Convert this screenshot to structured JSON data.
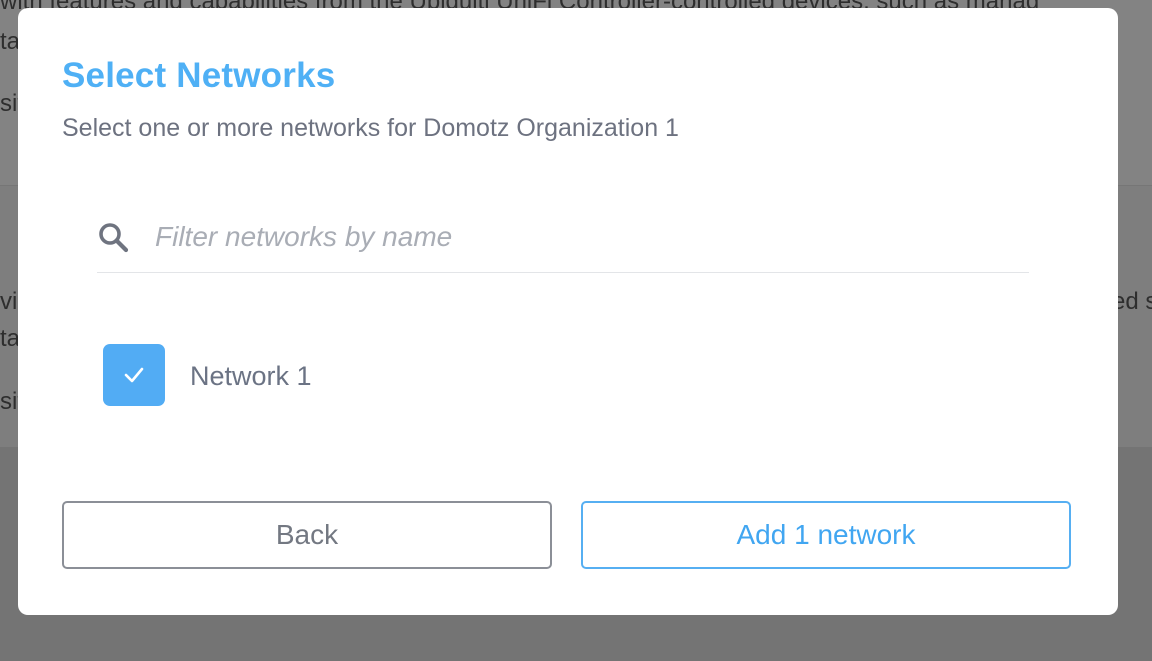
{
  "background": {
    "line_1": "with features and capabilities from the Ubiquiti UniFi Controller-controlled devices, such as manag",
    "line_2": "ta",
    "line_3": "sit",
    "line_4": "vi",
    "line_5": "ta",
    "line_6": "sit",
    "line_7": "ed s"
  },
  "modal": {
    "title": "Select Networks",
    "subtitle": "Select one or more networks for Domotz Organization 1",
    "filter": {
      "placeholder": "Filter networks by name",
      "value": ""
    },
    "networks": [
      {
        "label": "Network 1",
        "checked": true
      }
    ],
    "buttons": {
      "back_label": "Back",
      "add_label": "Add 1 network"
    }
  },
  "colors": {
    "accent": "#4fb0f5",
    "checkbox": "#52acf4",
    "overlay": "#7c7c7c"
  },
  "icons": {
    "search": "search-icon",
    "check": "checkmark-icon"
  }
}
